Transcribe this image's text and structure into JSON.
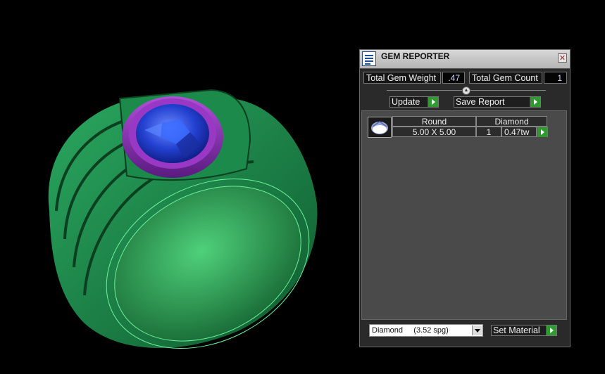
{
  "panel": {
    "title": "GEM REPORTER",
    "close_glyph": "✕",
    "total_weight_label": "Total Gem Weight",
    "total_weight_value": ".47",
    "total_count_label": "Total Gem Count",
    "total_count_value": "1",
    "update_label": "Update",
    "save_report_label": "Save Report"
  },
  "report": {
    "rows": [
      {
        "shape": "Round",
        "material": "Diamond",
        "size": "5.00 X 5.00",
        "count": "1",
        "weight": "0.47tw"
      }
    ]
  },
  "material": {
    "selected": "Diamond     (3.52 spg)",
    "set_label": "Set Material"
  },
  "viewport": {
    "band_color": "#1f8f4c",
    "stone_color": "#2a3fd8",
    "bezel_color": "#8a2aa8"
  }
}
